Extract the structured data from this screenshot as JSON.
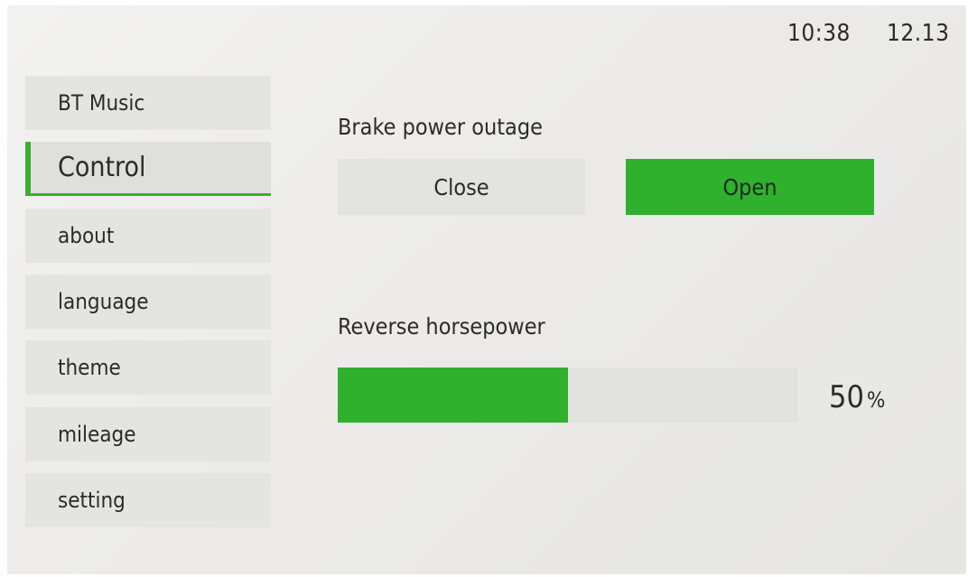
{
  "status": {
    "time": "10:38",
    "date": "12.13"
  },
  "sidebar": {
    "items": [
      {
        "label": "BT Music",
        "active": false
      },
      {
        "label": "Control",
        "active": true
      },
      {
        "label": "about",
        "active": false
      },
      {
        "label": "language",
        "active": false
      },
      {
        "label": "theme",
        "active": false
      },
      {
        "label": "mileage",
        "active": false
      },
      {
        "label": "setting",
        "active": false
      }
    ]
  },
  "control": {
    "brake": {
      "label": "Brake power outage",
      "close_label": "Close",
      "open_label": "Open",
      "selected": "Open"
    },
    "reverse": {
      "label": "Reverse horsepower",
      "value": "50",
      "unit": "%",
      "level": 0.5
    }
  },
  "colors": {
    "accent": "#2fb12e",
    "panel": "#e3e3e1",
    "background": "#ecebe9"
  }
}
